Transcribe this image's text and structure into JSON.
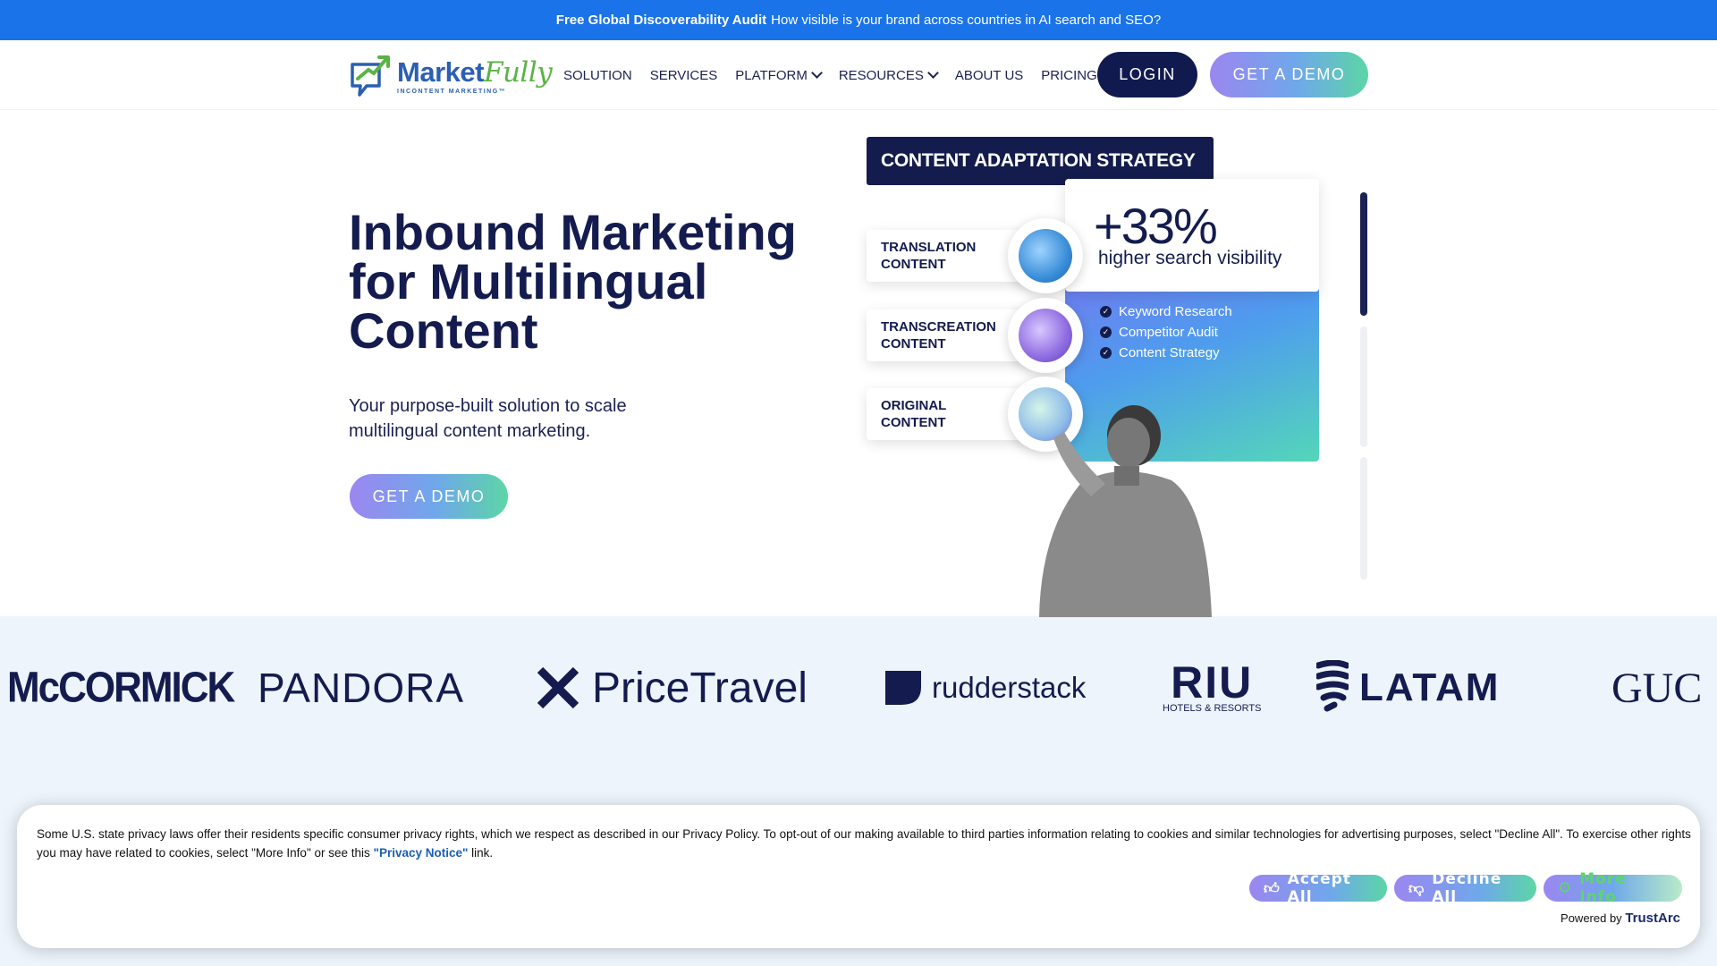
{
  "announcement": {
    "bold": "Free Global Discoverability Audit",
    "text": "How visible is your brand across countries in AI search and SEO?"
  },
  "logo": {
    "word_a": "Market",
    "word_b": "Fully",
    "tagline": "INCONTENT MARKETING™"
  },
  "nav": {
    "items": [
      "SOLUTION",
      "SERVICES",
      "PLATFORM",
      "RESOURCES",
      "ABOUT US",
      "PRICING"
    ],
    "login": "LOGIN",
    "demo": "GET A DEMO"
  },
  "hero": {
    "title": "Inbound Marketing for Multilingual Content",
    "subtitle": "Your purpose-built solution to scale multilingual content marketing.",
    "cta": "GET A DEMO"
  },
  "graphic": {
    "header": "CONTENT ADAPTATION STRATEGY",
    "stat": "+33%",
    "stat_label": "higher search visibility",
    "checks": [
      "Keyword Research",
      "Competitor Audit",
      "Content Strategy"
    ],
    "cards": [
      {
        "line1": "TRANSLATION",
        "line2": "CONTENT"
      },
      {
        "line1": "TRANSCREATION",
        "line2": "CONTENT"
      },
      {
        "line1": "ORIGINAL",
        "line2": "CONTENT"
      }
    ]
  },
  "clients": {
    "mccormick": "McCORMICK",
    "pandora": "PANDORA",
    "pricetravel": "PriceTravel",
    "rudderstack": "rudderstack",
    "riu": "RIU",
    "riu_sub": "HOTELS & RESORTS",
    "latam": "LATAM",
    "gucci": "GUC"
  },
  "cookie": {
    "text": "Some U.S. state privacy laws offer their residents specific consumer privacy rights, which we respect as described in our Privacy Policy. To opt-out of our making available to third parties information relating to cookies and similar technologies for advertising purposes, select \"Decline All\". To exercise other rights you may have related to cookies, select \"More Info\" or see this",
    "link": "\"Privacy Notice\"",
    "link_suffix": "link.",
    "accept": "Accept All",
    "decline": "Decline All",
    "more": "More Info",
    "powered_by": "Powered by",
    "brand": "TrustArc"
  },
  "colors": {
    "announcement_bg": "#1a73e8",
    "navy": "#131c4d",
    "brand_blue": "#2b5fb3",
    "brand_green": "#5ab345"
  }
}
